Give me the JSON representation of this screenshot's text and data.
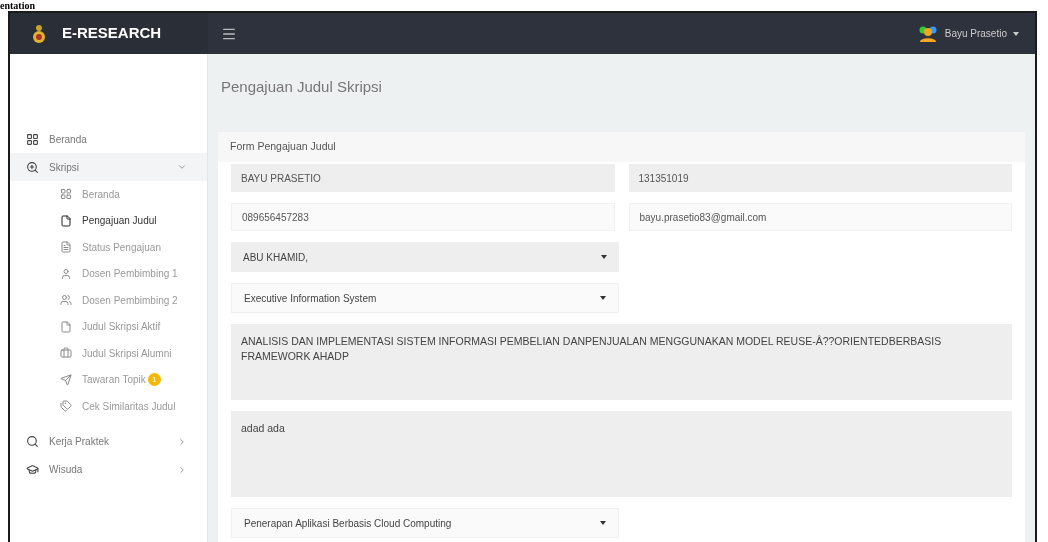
{
  "document_heading": "entation",
  "header": {
    "brand": "E-RESEARCH",
    "user": "Bayu Prasetio"
  },
  "sidebar": {
    "items": [
      {
        "label": "Beranda",
        "kind": "link",
        "expanded": false
      },
      {
        "label": "Skripsi",
        "kind": "group",
        "expanded": true,
        "children": [
          {
            "label": "Beranda",
            "selected": false
          },
          {
            "label": "Pengajuan Judul",
            "selected": true
          },
          {
            "label": "Status Pengajuan",
            "selected": false
          },
          {
            "label": "Dosen Pembimbing 1",
            "selected": false
          },
          {
            "label": "Dosen Pembimbing 2",
            "selected": false
          },
          {
            "label": "Judul Skripsi Aktif",
            "selected": false
          },
          {
            "label": "Judul Skripsi Alumni",
            "selected": false
          },
          {
            "label": "Tawaran Topik",
            "selected": false,
            "badge": "1"
          },
          {
            "label": "Cek Similaritas Judul",
            "selected": false
          }
        ]
      },
      {
        "label": "Kerja Praktek",
        "kind": "group",
        "expanded": false
      },
      {
        "label": "Wisuda",
        "kind": "group",
        "expanded": false
      }
    ]
  },
  "page_title": "Pengajuan Judul Skripsi",
  "form": {
    "title": "Form Pengajuan Judul",
    "rows": [
      [
        {
          "kind": "text",
          "value": "BAYU PRASETIO",
          "disabled": true
        },
        {
          "kind": "text",
          "value": "131351019",
          "disabled": true
        }
      ],
      [
        {
          "kind": "text",
          "value": "089656457283",
          "disabled": false
        },
        {
          "kind": "text",
          "value": "bayu.prasetio83@gmail.com",
          "disabled": false
        }
      ],
      [
        {
          "kind": "select",
          "value": "ABU KHAMID,",
          "disabled": true
        }
      ],
      [
        {
          "kind": "select",
          "value": "Executive Information System",
          "disabled": false
        }
      ],
      [
        {
          "kind": "textarea",
          "value": "ANALISIS DAN IMPLEMENTASI SISTEM INFORMASI PEMBELIAN DANPENJUALAN MENGGUNAKAN MODEL REUSE-Â??ORIENTEDBERBASIS FRAMEWORK AHADP",
          "disabled": true
        }
      ],
      [
        {
          "kind": "textarea",
          "value": "adad ada",
          "disabled": true
        }
      ],
      [
        {
          "kind": "select",
          "value": "Penerapan Aplikasi Berbasis Cloud Computing",
          "disabled": false
        }
      ]
    ]
  }
}
